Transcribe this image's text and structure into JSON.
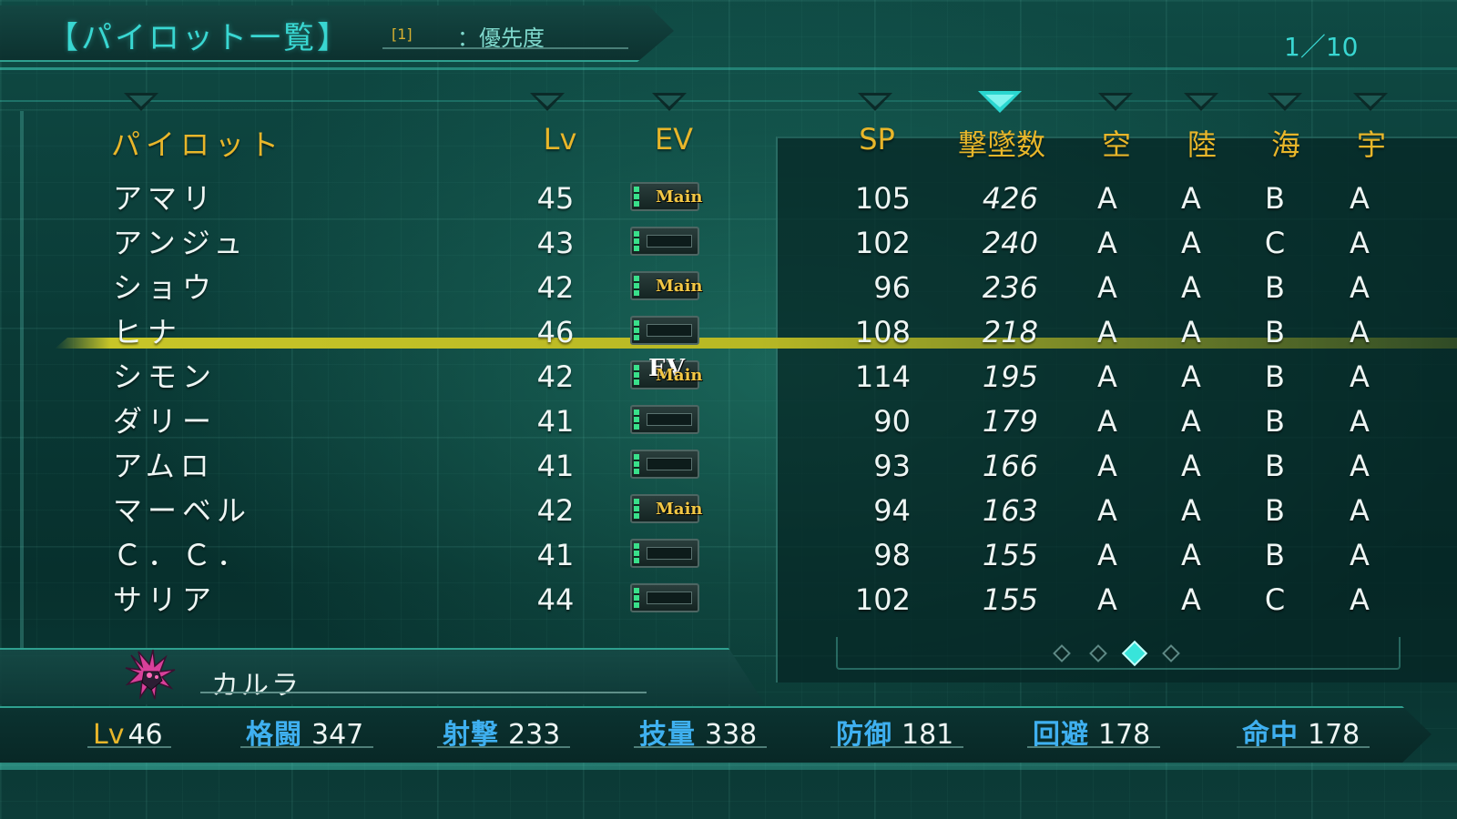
{
  "header": {
    "title": "【パイロット一覧】",
    "sort_key": "[1]",
    "sort_label": "：優先度",
    "page": "1／10"
  },
  "columns": {
    "pilot": "パイロット",
    "lv": "Lv",
    "ev": "EV",
    "sp": "SP",
    "kills": "撃墜数",
    "air": "空",
    "land": "陸",
    "sea": "海",
    "space": "宇"
  },
  "active_sort_column": "kills",
  "rows": [
    {
      "name": "アマリ",
      "lv": "45",
      "ev_main": "Main",
      "ev_tag": "",
      "sp": "105",
      "kills": "426",
      "air": "A",
      "land": "A",
      "sea": "B",
      "space": "A"
    },
    {
      "name": "アンジュ",
      "lv": "43",
      "ev_main": "",
      "ev_tag": "",
      "sp": "102",
      "kills": "240",
      "air": "A",
      "land": "A",
      "sea": "C",
      "space": "A"
    },
    {
      "name": "ショウ",
      "lv": "42",
      "ev_main": "Main",
      "ev_tag": "",
      "sp": "96",
      "kills": "236",
      "air": "A",
      "land": "A",
      "sea": "B",
      "space": "A"
    },
    {
      "name": "ヒナ",
      "lv": "46",
      "ev_main": "",
      "ev_tag": "",
      "sp": "108",
      "kills": "218",
      "air": "A",
      "land": "A",
      "sea": "B",
      "space": "A"
    },
    {
      "name": "シモン",
      "lv": "42",
      "ev_main": "Main",
      "ev_tag": "EV",
      "sp": "114",
      "kills": "195",
      "air": "A",
      "land": "A",
      "sea": "B",
      "space": "A"
    },
    {
      "name": "ダリー",
      "lv": "41",
      "ev_main": "",
      "ev_tag": "",
      "sp": "90",
      "kills": "179",
      "air": "A",
      "land": "A",
      "sea": "B",
      "space": "A"
    },
    {
      "name": "アムロ",
      "lv": "41",
      "ev_main": "",
      "ev_tag": "",
      "sp": "93",
      "kills": "166",
      "air": "A",
      "land": "A",
      "sea": "B",
      "space": "A"
    },
    {
      "name": "マーベル",
      "lv": "42",
      "ev_main": "Main",
      "ev_tag": "",
      "sp": "94",
      "kills": "163",
      "air": "A",
      "land": "A",
      "sea": "B",
      "space": "A"
    },
    {
      "name": "Ｃ．Ｃ．",
      "lv": "41",
      "ev_main": "",
      "ev_tag": "",
      "sp": "98",
      "kills": "155",
      "air": "A",
      "land": "A",
      "sea": "B",
      "space": "A"
    },
    {
      "name": "サリア",
      "lv": "44",
      "ev_main": "",
      "ev_tag": "",
      "sp": "102",
      "kills": "155",
      "air": "A",
      "land": "A",
      "sea": "C",
      "space": "A"
    }
  ],
  "pages": {
    "count": 4,
    "active": 3
  },
  "selected": {
    "name": "カルラ",
    "icon": "pink-mech-portrait-icon",
    "stats": {
      "lv_label": "Lv",
      "lv": "46",
      "melee_label": "格闘",
      "melee": "347",
      "ranged_label": "射撃",
      "ranged": "233",
      "skill_label": "技量",
      "skill": "338",
      "defense_label": "防御",
      "defense": "181",
      "evade_label": "回避",
      "evade": "178",
      "accuracy_label": "命中",
      "accuracy": "178"
    }
  },
  "colors": {
    "accent": "#39d7d2",
    "header_gold": "#e8b62a",
    "stat_label_blue": "#3fb0f0",
    "highlight": "#c8c628"
  }
}
